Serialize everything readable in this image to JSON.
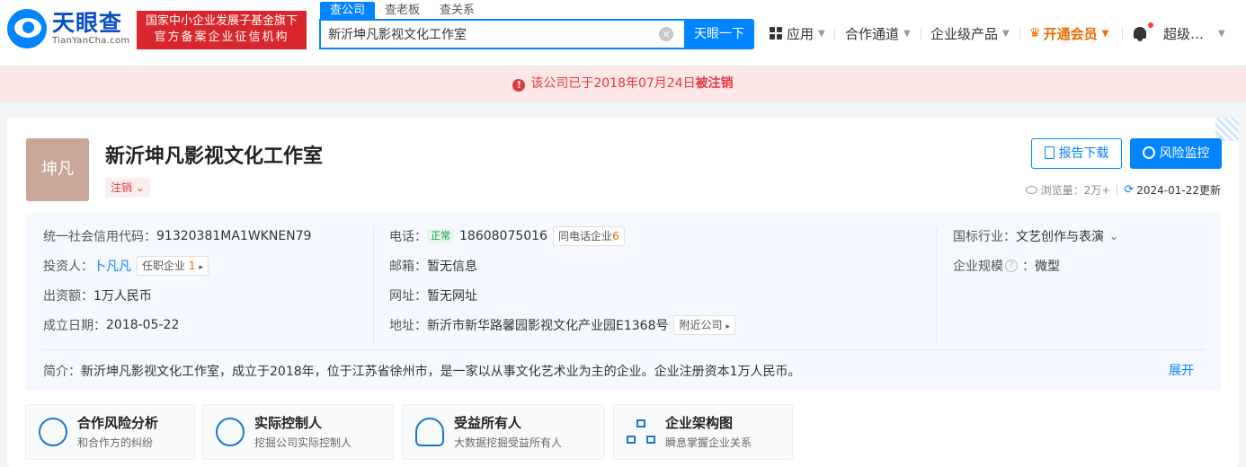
{
  "header": {
    "logo_cn": "天眼查",
    "logo_en": "TianYanCha.com",
    "badge_line1": "国家中小企业发展子基金旗下",
    "badge_line2": "官方备案企业征信机构",
    "search_tabs": [
      "查公司",
      "查老板",
      "查关系"
    ],
    "search_value": "新沂坤凡影视文化工作室",
    "search_clear": "×",
    "search_button": "天眼一下",
    "nav": {
      "apps": "应用",
      "channel": "合作通道",
      "enterprise": "企业级产品",
      "vip": "开通会员",
      "user": "超级…"
    }
  },
  "notice": {
    "prefix": "该公司已于2018年07月24日",
    "emphasis": "被注销"
  },
  "company": {
    "logo_text": "坤凡",
    "name": "新沂坤凡影视文化工作室",
    "status": "注销",
    "report_button": "报告下载",
    "risk_button": "风险监控",
    "views_label": "浏览量：2万+",
    "updated": "2024-01-22更新"
  },
  "info": {
    "credit_code_label": "统一社会信用代码：",
    "credit_code": "91320381MA1WKNEN79",
    "investor_label": "投资人：",
    "investor": "卜凡凡",
    "investor_tag": "任职企业",
    "investor_tag_count": "1",
    "capital_label": "出资额：",
    "capital": "1万人民币",
    "founded_label": "成立日期：",
    "founded": "2018-05-22",
    "phone_label": "电话：",
    "phone_status": "正常",
    "phone": "18608075016",
    "same_phone_tag": "同电话企业",
    "same_phone_count": "6",
    "email_label": "邮箱：",
    "email": "暂无信息",
    "website_label": "网址：",
    "website": "暂无网址",
    "address_label": "地址：",
    "address": "新沂市新华路馨园影视文化产业园E1368号",
    "nearby_tag": "附近公司",
    "industry_label": "国标行业：",
    "industry": "文艺创作与表演",
    "scale_label": "企业规模",
    "scale": "微型",
    "intro_label": "简介：",
    "intro": "新沂坤凡影视文化工作室，成立于2018年，位于江苏省徐州市，是一家以从事文化艺术业为主的企业。企业注册资本1万人民币。",
    "expand": "展开"
  },
  "features": [
    {
      "title": "合作风险分析",
      "sub": "和合作方的纠纷",
      "icon": "handshake-icon"
    },
    {
      "title": "实际控制人",
      "sub": "挖掘公司实际控制人",
      "icon": "target-icon"
    },
    {
      "title": "受益所有人",
      "sub": "大数据挖掘受益所有人",
      "icon": "person-icon"
    },
    {
      "title": "企业架构图",
      "sub": "瞬息掌握企业关系",
      "icon": "org-chart-icon"
    }
  ]
}
